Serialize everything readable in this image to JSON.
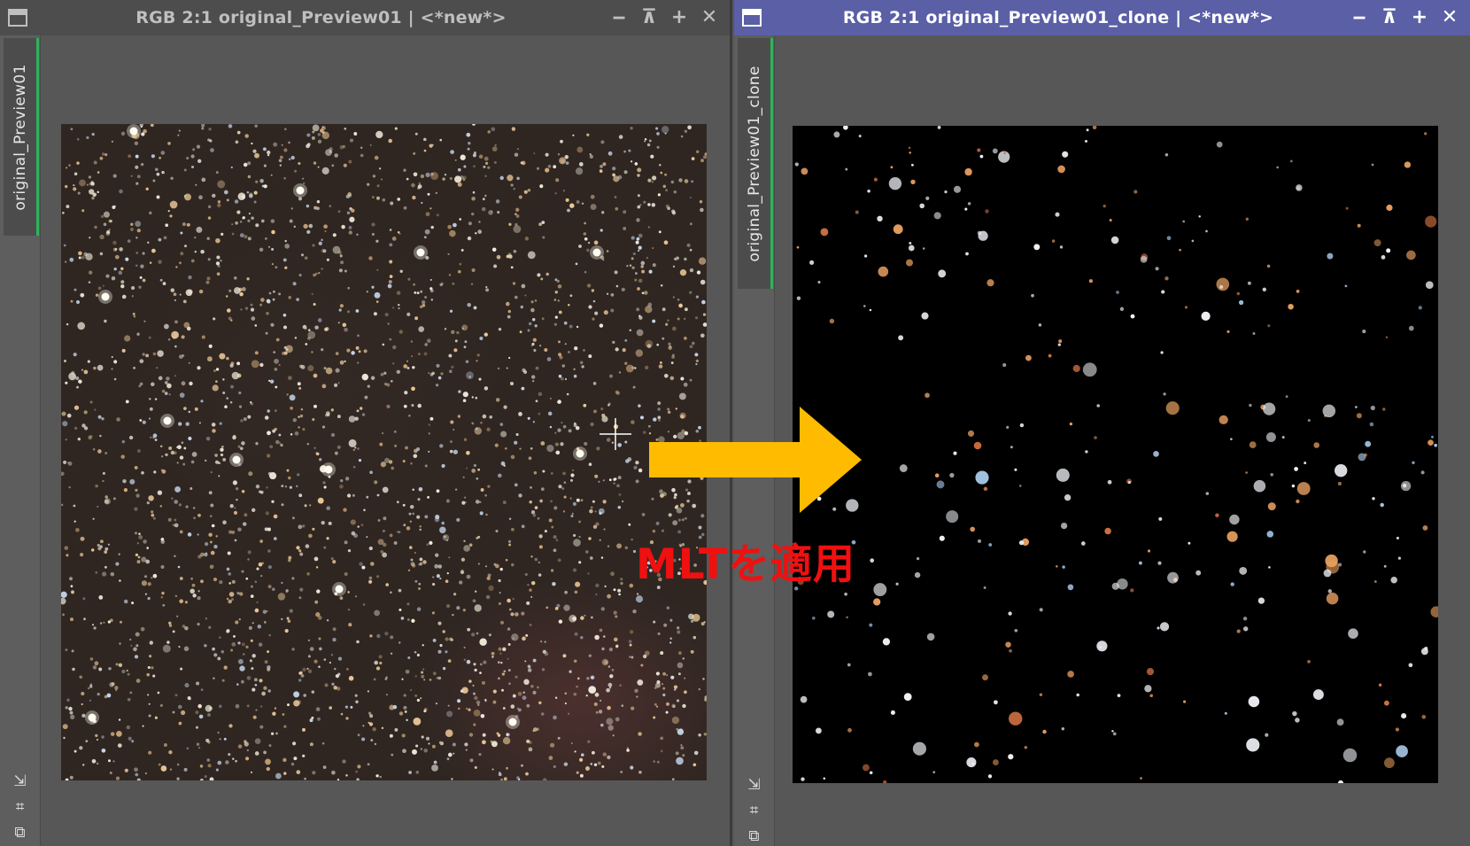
{
  "windows": {
    "left": {
      "title": "RGB 2:1 original_Preview01 | <*new*>",
      "tab_label": "original_Preview01",
      "active": false
    },
    "right": {
      "title": "RGB 2:1 original_Preview01_clone | <*new*>",
      "tab_label": "original_Preview01_clone",
      "active": true
    }
  },
  "title_buttons": [
    "minimize",
    "shade",
    "maximize",
    "close"
  ],
  "title_button_glyphs": {
    "minimize": "‒",
    "shade": "⊼",
    "maximize": "+",
    "close": "✕"
  },
  "side_icons": [
    "fit-view-icon",
    "zoom-frame-icon",
    "clone-view-icon"
  ],
  "side_icon_glyphs": [
    "⇲",
    "⌗",
    "⧉"
  ],
  "annotation": {
    "label": "MLTを適用",
    "arrow_color": "#ffbb00",
    "label_color": "#f01010"
  },
  "colors": {
    "active_title": "#5a5fa6",
    "inactive_title": "#4d4d4d",
    "workspace": "#575757",
    "tab_accent": "#2fb35a"
  }
}
